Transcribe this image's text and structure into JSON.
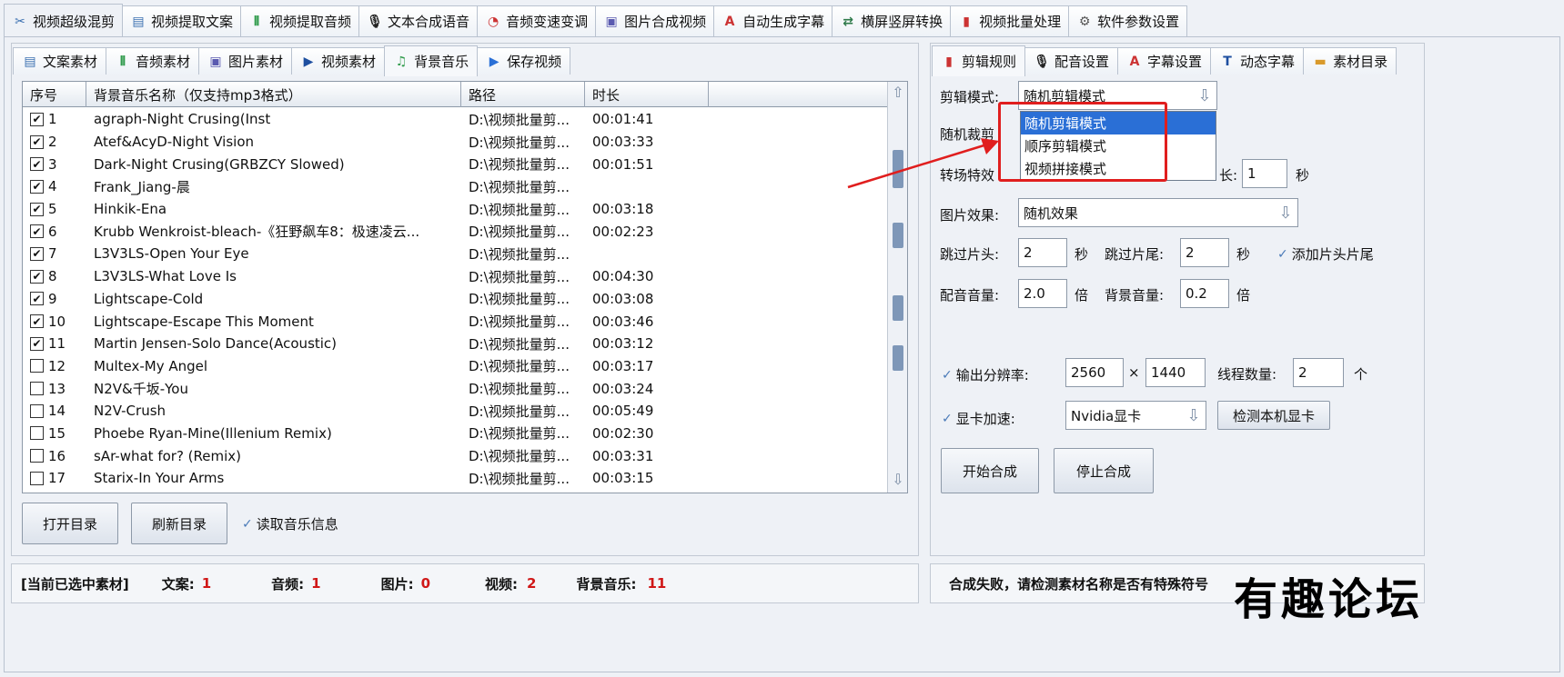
{
  "top_tabs": [
    {
      "label": "视频超级混剪",
      "icon": "✂",
      "icon_name": "scissors-icon",
      "active": true
    },
    {
      "label": "视频提取文案",
      "icon": "▤",
      "icon_name": "document-icon"
    },
    {
      "label": "视频提取音频",
      "icon": "⦀",
      "icon_name": "waveform-icon"
    },
    {
      "label": "文本合成语音",
      "icon": "🎙",
      "icon_name": "microphone-icon"
    },
    {
      "label": "音频变速变调",
      "icon": "◔",
      "icon_name": "gauge-icon"
    },
    {
      "label": "图片合成视频",
      "icon": "▣",
      "icon_name": "image-icon"
    },
    {
      "label": "自动生成字幕",
      "icon": "A",
      "icon_name": "subtitle-icon"
    },
    {
      "label": "横屏竖屏转换",
      "icon": "⇄",
      "icon_name": "rotate-screen-icon"
    },
    {
      "label": "视频批量处理",
      "icon": "▮",
      "icon_name": "film-icon"
    },
    {
      "label": "软件参数设置",
      "icon": "⚙",
      "icon_name": "gear-icon"
    }
  ],
  "sub_tabs": [
    {
      "label": "文案素材",
      "icon": "▤",
      "icon_name": "document-icon"
    },
    {
      "label": "音频素材",
      "icon": "⦀",
      "icon_name": "waveform-icon"
    },
    {
      "label": "图片素材",
      "icon": "▣",
      "icon_name": "image-icon"
    },
    {
      "label": "视频素材",
      "icon": "▶",
      "icon_name": "play-icon"
    },
    {
      "label": "背景音乐",
      "icon": "♫",
      "icon_name": "music-note-icon",
      "active": true
    },
    {
      "label": "保存视频",
      "icon": "▶",
      "icon_name": "save-video-icon"
    }
  ],
  "table": {
    "headers": [
      "序号",
      "背景音乐名称（仅支持mp3格式）",
      "路径",
      "时长"
    ],
    "rows": [
      {
        "no": "1",
        "checked": true,
        "name": "agraph-Night Crusing(Inst",
        "path": "D:\\视频批量剪...",
        "duration": "00:01:41"
      },
      {
        "no": "2",
        "checked": true,
        "name": "Atef&AcyD-Night Vision",
        "path": "D:\\视频批量剪...",
        "duration": "00:03:33"
      },
      {
        "no": "3",
        "checked": true,
        "name": "Dark-Night Crusing(GRBZCY Slowed)",
        "path": "D:\\视频批量剪...",
        "duration": "00:01:51"
      },
      {
        "no": "4",
        "checked": true,
        "name": "Frank_Jiang-晨",
        "path": "D:\\视频批量剪...",
        "duration": ""
      },
      {
        "no": "5",
        "checked": true,
        "name": "Hinkik-Ena",
        "path": "D:\\视频批量剪...",
        "duration": "00:03:18"
      },
      {
        "no": "6",
        "checked": true,
        "name": "Krubb Wenkroist-bleach-《狂野飙车8：极速凌云...",
        "path": "D:\\视频批量剪...",
        "duration": "00:02:23"
      },
      {
        "no": "7",
        "checked": true,
        "name": "L3V3LS-Open Your Eye",
        "path": "D:\\视频批量剪...",
        "duration": ""
      },
      {
        "no": "8",
        "checked": true,
        "name": "L3V3LS-What Love Is",
        "path": "D:\\视频批量剪...",
        "duration": "00:04:30"
      },
      {
        "no": "9",
        "checked": true,
        "name": "Lightscape-Cold",
        "path": "D:\\视频批量剪...",
        "duration": "00:03:08"
      },
      {
        "no": "10",
        "checked": true,
        "name": "Lightscape-Escape This Moment",
        "path": "D:\\视频批量剪...",
        "duration": "00:03:46"
      },
      {
        "no": "11",
        "checked": true,
        "name": "Martin Jensen-Solo Dance(Acoustic)",
        "path": "D:\\视频批量剪...",
        "duration": "00:03:12"
      },
      {
        "no": "12",
        "checked": false,
        "name": "Multex-My Angel",
        "path": "D:\\视频批量剪...",
        "duration": "00:03:17"
      },
      {
        "no": "13",
        "checked": false,
        "name": "N2V&千坂-You",
        "path": "D:\\视频批量剪...",
        "duration": "00:03:24"
      },
      {
        "no": "14",
        "checked": false,
        "name": "N2V-Crush",
        "path": "D:\\视频批量剪...",
        "duration": "00:05:49"
      },
      {
        "no": "15",
        "checked": false,
        "name": "Phoebe Ryan-Mine(Illenium Remix)",
        "path": "D:\\视频批量剪...",
        "duration": "00:02:30"
      },
      {
        "no": "16",
        "checked": false,
        "name": "sAr-what for? (Remix)",
        "path": "D:\\视频批量剪...",
        "duration": "00:03:31"
      },
      {
        "no": "17",
        "checked": false,
        "name": "Starix-In Your Arms",
        "path": "D:\\视频批量剪...",
        "duration": "00:03:15"
      }
    ]
  },
  "left_buttons": {
    "open_dir": "打开目录",
    "refresh_dir": "刷新目录",
    "read_info": "读取音乐信息"
  },
  "status_left": {
    "title": "[当前已选中素材]",
    "items": [
      {
        "label": "文案:",
        "value": "1"
      },
      {
        "label": "音频:",
        "value": "1"
      },
      {
        "label": "图片:",
        "value": "0"
      },
      {
        "label": "视频:",
        "value": "2"
      },
      {
        "label": "背景音乐:",
        "value": "11"
      }
    ]
  },
  "right_tabs": [
    {
      "label": "剪辑规则",
      "icon": "▮",
      "icon_name": "film-icon",
      "active": true
    },
    {
      "label": "配音设置",
      "icon": "🎙",
      "icon_name": "microphone-icon"
    },
    {
      "label": "字幕设置",
      "icon": "A",
      "icon_name": "subtitle-icon"
    },
    {
      "label": "动态字幕",
      "icon": "T",
      "icon_name": "text-box-icon"
    },
    {
      "label": "素材目录",
      "icon": "▬",
      "icon_name": "folder-icon"
    }
  ],
  "settings": {
    "mode_label": "剪辑模式:",
    "mode_value": "随机剪辑模式",
    "mode_options": [
      "随机剪辑模式",
      "顺序剪辑模式",
      "视频拼接模式"
    ],
    "crop_label": "随机裁剪",
    "transition_label": "转场特效",
    "duration_suffix_label": "长:",
    "duration_value": "1",
    "sec_unit": "秒",
    "image_effect_label": "图片效果:",
    "image_effect_value": "随机效果",
    "skip_head_label": "跳过片头:",
    "skip_head_value": "2",
    "skip_tail_label": "跳过片尾:",
    "skip_tail_value": "2",
    "add_head_tail_label": "添加片头片尾",
    "voice_vol_label": "配音音量:",
    "voice_vol_value": "2.0",
    "times_unit": "倍",
    "bg_vol_label": "背景音量:",
    "bg_vol_value": "0.2",
    "resolution_label": "输出分辨率:",
    "res_w": "2560",
    "res_x": "×",
    "res_h": "1440",
    "threads_label": "线程数量:",
    "threads_value": "2",
    "threads_unit": "个",
    "gpu_label": "显卡加速:",
    "gpu_value": "Nvidia显卡",
    "detect_gpu_button": "检测本机显卡",
    "start_button": "开始合成",
    "stop_button": "停止合成"
  },
  "status_right": "合成失败，请检测素材名称是否有特殊符号",
  "watermark": "有趣论坛",
  "colors": {
    "accent": "#2a6fd6",
    "highlight_red": "#e01e1e",
    "count_red": "#d01818"
  }
}
